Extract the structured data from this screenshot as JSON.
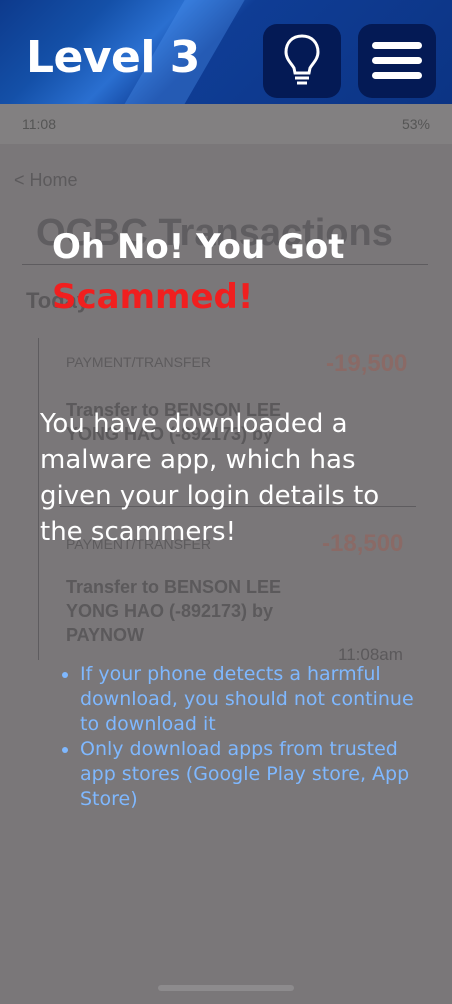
{
  "header": {
    "level_title": "Level 3",
    "hint_icon": "lightbulb-icon",
    "menu_icon": "hamburger-menu-icon"
  },
  "background_screen": {
    "status_time": "11:08",
    "status_right": "53%",
    "back_label": "< Home",
    "title": "OCBC Transactions",
    "section": "Today",
    "transactions": [
      {
        "category": "PAYMENT/TRANSFER",
        "amount": "-19,500",
        "description": "Transfer to BENSON LEE YONG HAO (-892173) by"
      },
      {
        "category": "PAYMENT/TRANSFER",
        "amount": "-18,500",
        "description": "Transfer to BENSON LEE YONG HAO (-892173) by PAYNOW",
        "time": "11:08am"
      }
    ]
  },
  "overlay": {
    "heading_line1": "Oh No! You Got",
    "heading_line2": "Scammed!",
    "message": "You have downloaded a malware app, which has given your login details to the scammers!",
    "tips": [
      "If your phone detects a harmful download, you should not continue to download it",
      "Only download apps from trusted app stores (Google Play store, App Store)"
    ]
  },
  "colors": {
    "header_dark": "#041a55",
    "scam_red": "#f01f1f",
    "tip_blue": "#7fb8ff",
    "overlay_bg": "#7a7779"
  }
}
